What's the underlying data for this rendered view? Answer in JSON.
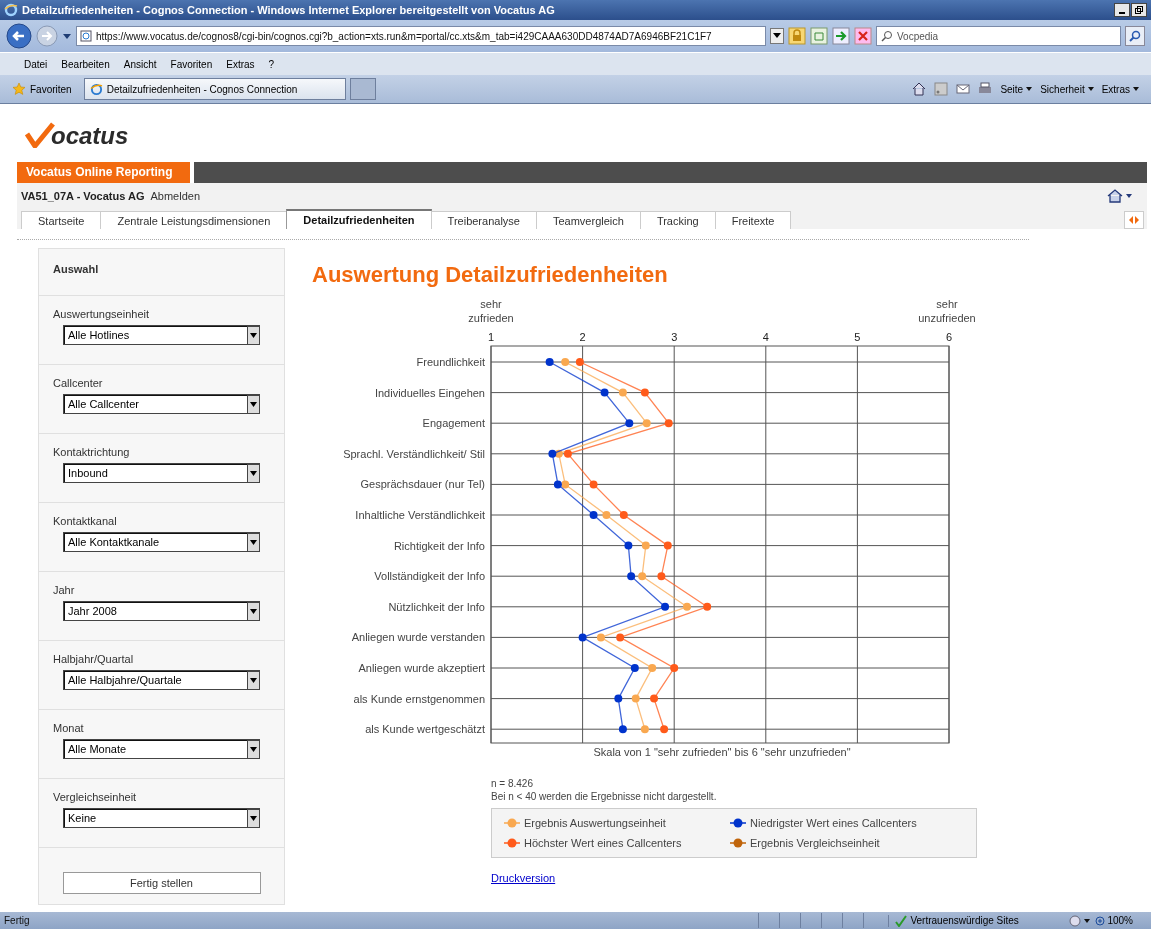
{
  "window": {
    "title": "Detailzufriedenheiten - Cognos Connection - Windows Internet Explorer bereitgestellt von Vocatus AG"
  },
  "address_bar": {
    "url": "https://www.vocatus.de/cognos8/cgi-bin/cognos.cgi?b_action=xts.run&m=portal/cc.xts&m_tab=i429CAAA630DD4874AD7A6946BF21C1F7",
    "search_value": "Vocpedia"
  },
  "menu": [
    "Datei",
    "Bearbeiten",
    "Ansicht",
    "Favoriten",
    "Extras",
    "?"
  ],
  "favorites_bar": {
    "label": "Favoriten",
    "tab": "Detailzufriedenheiten - Cognos Connection",
    "tools": [
      "Seite",
      "Sicherheit",
      "Extras"
    ]
  },
  "logo": {
    "text": "ocatus"
  },
  "portal": {
    "title": "Vocatus Online Reporting",
    "user": "VA51_07A - Vocatus AG",
    "logout": "Abmelden"
  },
  "tabs": [
    {
      "label": "Startseite",
      "selected": false
    },
    {
      "label": "Zentrale Leistungsdimensionen",
      "selected": false
    },
    {
      "label": "Detailzufriedenheiten",
      "selected": true
    },
    {
      "label": "Treiberanalyse",
      "selected": false
    },
    {
      "label": "Teamvergleich",
      "selected": false
    },
    {
      "label": "Tracking",
      "selected": false
    },
    {
      "label": "Freitexte",
      "selected": false
    }
  ],
  "sidebar": {
    "title": "Auswahl",
    "filters": [
      {
        "label": "Auswertungseinheit",
        "value": "Alle Hotlines"
      },
      {
        "label": "Callcenter",
        "value": "Alle Callcenter"
      },
      {
        "label": "Kontaktrichtung",
        "value": "Inbound"
      },
      {
        "label": "Kontaktkanal",
        "value": "Alle Kontaktkanale"
      },
      {
        "label": "Jahr",
        "value": "Jahr 2008"
      },
      {
        "label": "Halbjahr/Quartal",
        "value": "Alle Halbjahre/Quartale"
      },
      {
        "label": "Monat",
        "value": "Alle Monate"
      },
      {
        "label": "Vergleichseinheit",
        "value": "Keine"
      }
    ],
    "button": "Fertig stellen"
  },
  "report": {
    "title": "Auswertung Detailzufriedenheiten",
    "scale_low": "sehr zufrieden",
    "scale_high": "sehr unzufrieden",
    "chart_data": {
      "type": "line",
      "orientation": "horizontal",
      "grid": true,
      "xlabel": "Skala von 1 \"sehr zufrieden\" bis 6 \"sehr unzufrieden\"",
      "xlim": [
        1,
        6
      ],
      "xticks": [
        1,
        2,
        3,
        4,
        5,
        6
      ],
      "categories": [
        "Freundlichkeit",
        "Individuelles Eingehen",
        "Engagement",
        "Sprachl. Verständlichkeit/ Stil",
        "Gesprächsdauer (nur Tel)",
        "Inhaltliche Verständlichkeit",
        "Richtigkeit der Info",
        "Vollständigkeit der Info",
        "Nützlichkeit der Info",
        "Anliegen wurde verstanden",
        "Anliegen wurde akzeptiert",
        "als Kunde ernstgenommen",
        "als Kunde wertgeschätzt"
      ],
      "series": [
        {
          "name": "Ergebnis Auswertungseinheit",
          "color": "#f9a850",
          "marker": "circle",
          "values": [
            1.81,
            2.44,
            2.7,
            1.74,
            1.81,
            2.26,
            2.69,
            2.65,
            3.14,
            2.2,
            2.76,
            2.58,
            2.68
          ]
        },
        {
          "name": "Niedrigster Wert eines Callcenters",
          "color": "#0033cc",
          "marker": "circle",
          "values": [
            1.64,
            2.24,
            2.51,
            1.67,
            1.73,
            2.12,
            2.5,
            2.53,
            2.9,
            2.0,
            2.57,
            2.39,
            2.44
          ]
        },
        {
          "name": "Höchster Wert eines Callcenters",
          "color": "#ff5a1a",
          "marker": "circle",
          "values": [
            1.97,
            2.68,
            2.94,
            1.84,
            2.12,
            2.45,
            2.93,
            2.86,
            3.36,
            2.41,
            3.0,
            2.78,
            2.89
          ]
        },
        {
          "name": "Ergebnis Vergleichseinheit",
          "color": "#c0640a",
          "marker": "circle",
          "values": [
            null,
            null,
            null,
            null,
            null,
            null,
            null,
            null,
            null,
            null,
            null,
            null,
            null
          ]
        }
      ]
    },
    "n": "n = 8.426",
    "note": "Bei n < 40 werden die Ergebnisse nicht dargestellt.",
    "print_link": "Druckversion"
  },
  "status_bar": {
    "text": "Fertig",
    "zone": "Vertrauenswürdige Sites",
    "zoom": "100%"
  }
}
